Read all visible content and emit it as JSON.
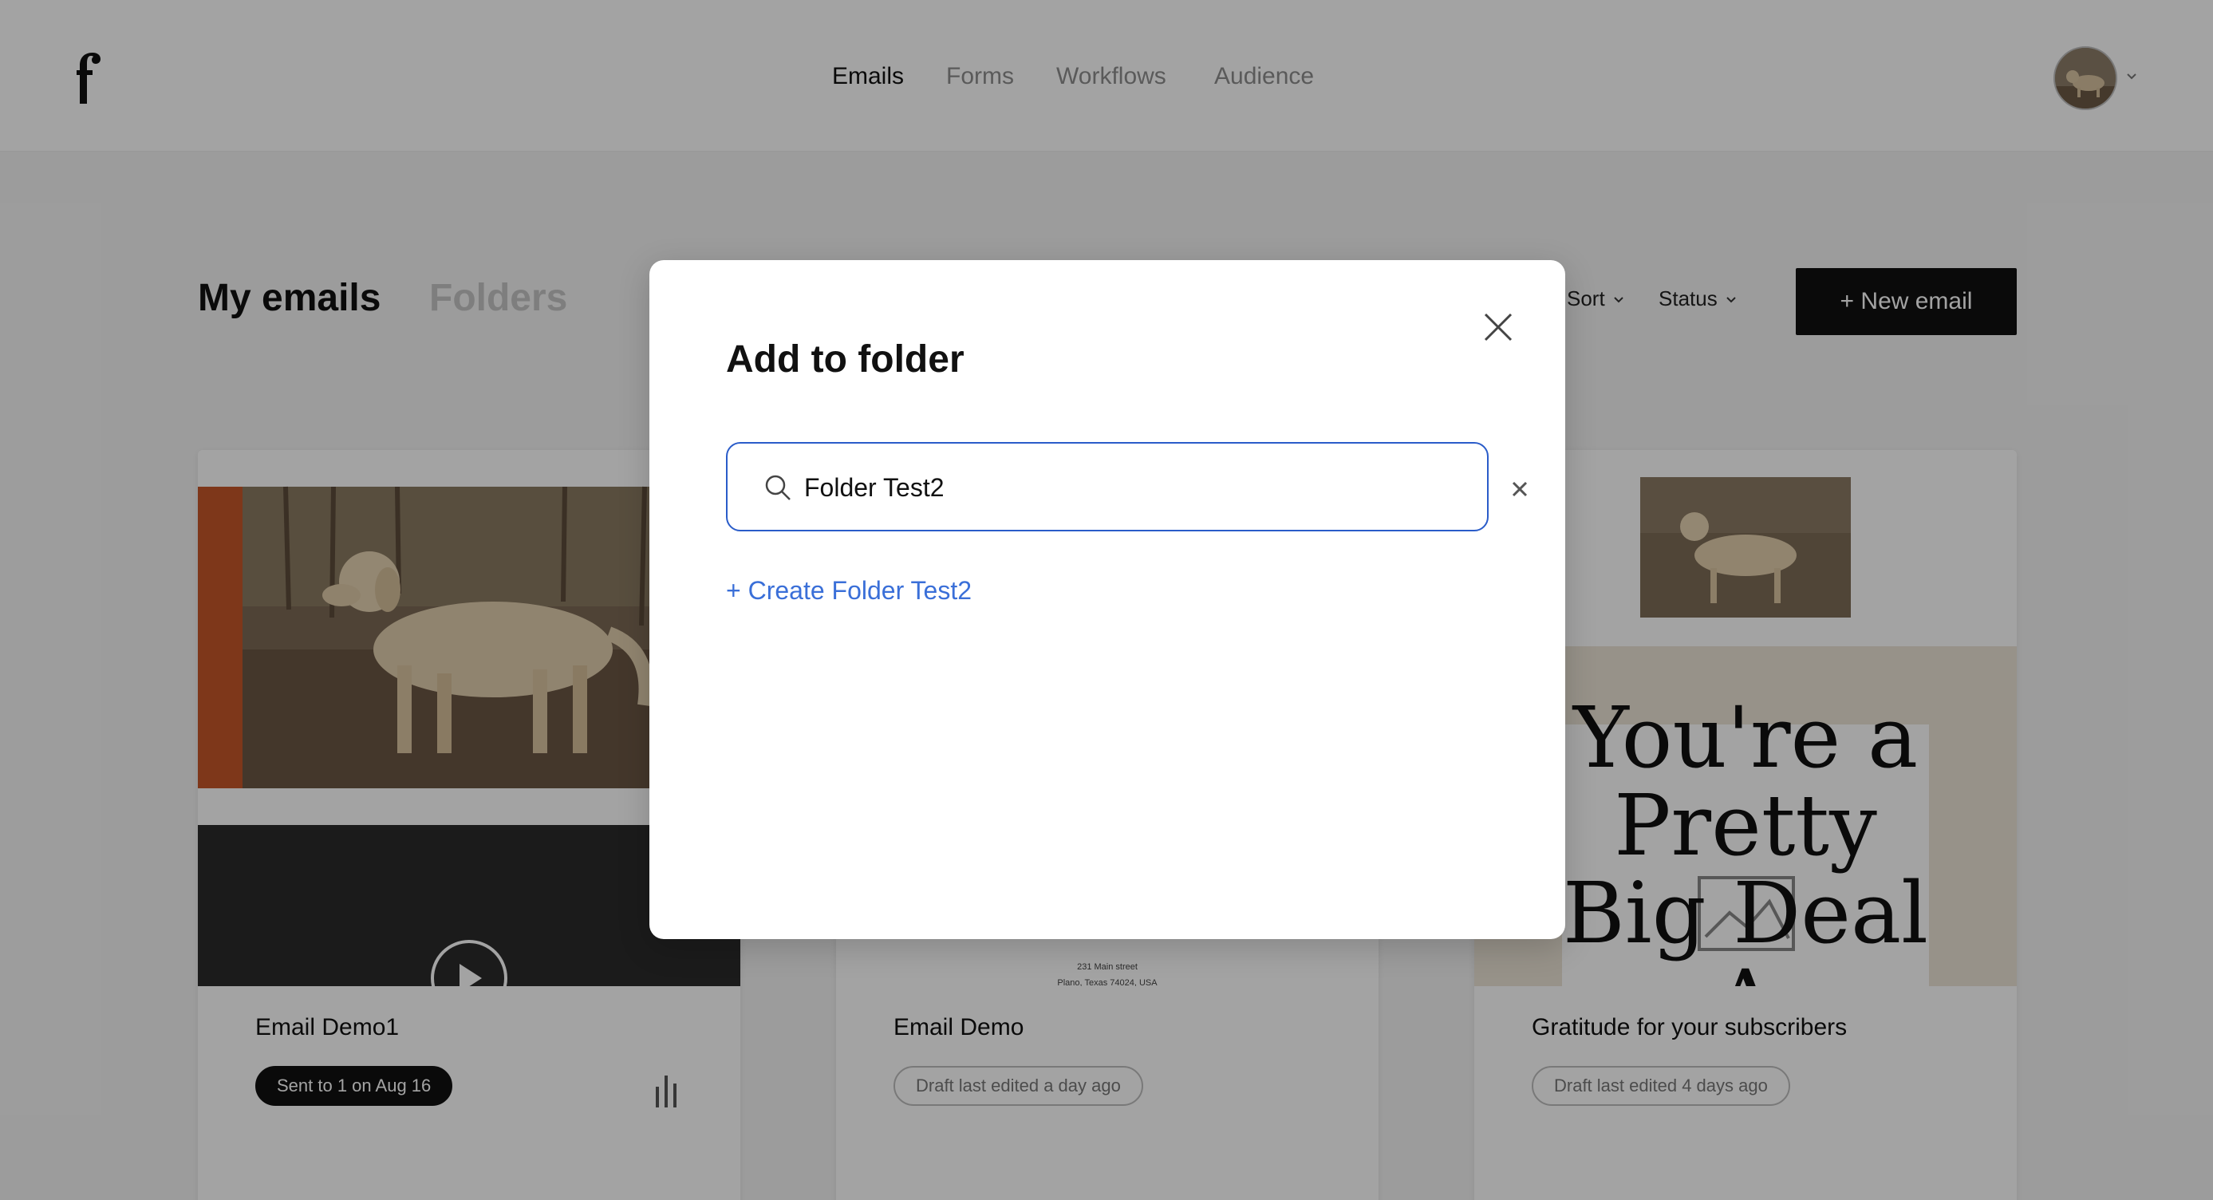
{
  "nav": {
    "items": [
      {
        "label": "Emails",
        "active": true
      },
      {
        "label": "Forms",
        "active": false
      },
      {
        "label": "Workflows",
        "active": false
      },
      {
        "label": "Audience",
        "active": false
      }
    ]
  },
  "page": {
    "tabs": [
      {
        "label": "My emails",
        "active": true
      },
      {
        "label": "Folders",
        "active": false
      }
    ],
    "filters": {
      "sort_label": "Sort",
      "status_label": "Status"
    },
    "new_email_label": "+ New email"
  },
  "cards": [
    {
      "title": "Email Demo1",
      "badge": "Sent to 1 on Aug 16",
      "badge_type": "sent"
    },
    {
      "title": "Email Demo",
      "badge": "Draft last edited a day ago",
      "badge_type": "draft",
      "footer_address": [
        "231 Main street",
        "Plano, Texas 74024, USA"
      ]
    },
    {
      "title": "Gratitude for your subscribers",
      "badge": "Draft last edited 4 days ago",
      "badge_type": "draft",
      "preview_heading": [
        "You're a",
        "Pretty",
        "Big Deal",
        "A"
      ]
    }
  ],
  "modal": {
    "title": "Add to folder",
    "search_value": "Folder Test2",
    "create_label": "+ Create Folder Test2"
  },
  "colors": {
    "accent_blue": "#3a6fd8",
    "input_border": "#2a5cc9",
    "primary_button": "#111111",
    "card_accent_orange": "#c5562a",
    "overlay": "rgba(0,0,0,0.36)"
  },
  "icons": [
    "logo-icon",
    "avatar",
    "chevron-down-icon",
    "play-icon",
    "bar-chart-icon",
    "close-icon",
    "search-icon",
    "clear-icon",
    "image-placeholder-icon"
  ]
}
